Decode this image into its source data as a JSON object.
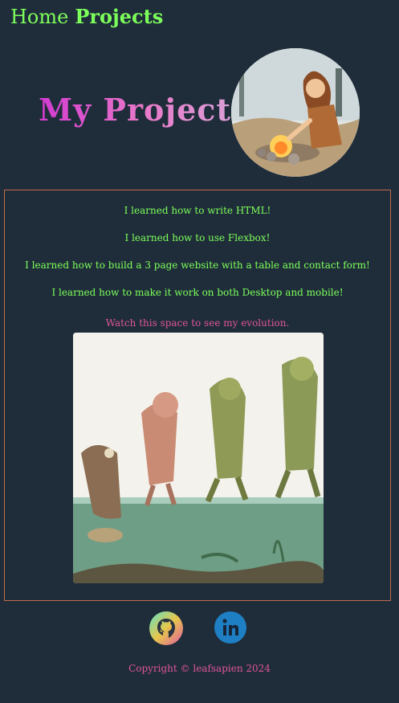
{
  "nav": {
    "home_label": "Home",
    "projects_label": "Projects"
  },
  "banner": {
    "title": "My Projects"
  },
  "learnings": [
    "I learned how to write HTML!",
    "I learned how to use Flexbox!",
    "I learned how to build a 3 page website with a table and contact form!",
    "I learned how to make it work on both Desktop and mobile!"
  ],
  "evolution": {
    "caption": "Watch this space to see my evolution."
  },
  "footer": {
    "social": [
      {
        "icon": "github-icon"
      },
      {
        "icon": "linkedin-icon"
      }
    ],
    "copyright": "Copyright © leafsapien 2024"
  },
  "colors": {
    "background": "#1f2d3a",
    "nav_text": "#7dff5a",
    "accent_pink": "#e0559a",
    "border": "#c06a4d",
    "linkedin_blue": "#1f7fc4"
  }
}
